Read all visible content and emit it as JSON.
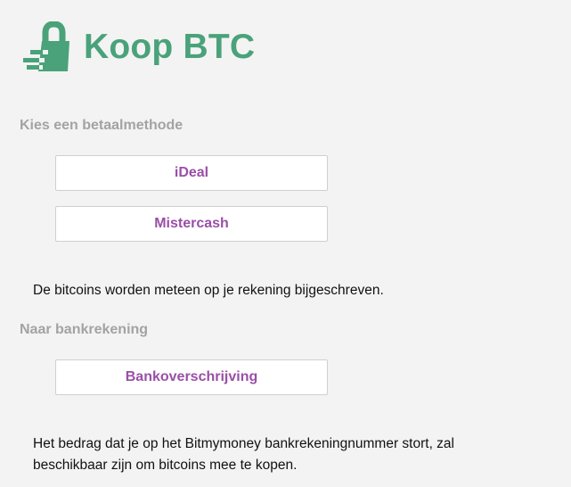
{
  "brand": {
    "title": "Koop BTC",
    "logo_icon": "padlock-speed-icon",
    "color": "#4aa27a"
  },
  "payment_section": {
    "label": "Kies een betaalmethode",
    "buttons": [
      {
        "label": "iDeal"
      },
      {
        "label": "Mistercash"
      }
    ],
    "note": "De bitcoins worden meteen op je rekening bijgeschreven."
  },
  "bank_section": {
    "label": "Naar bankrekening",
    "buttons": [
      {
        "label": "Bankoverschrijving"
      }
    ],
    "note_line1": "Het bedrag dat je op het Bitmymoney bankrekeningnummer stort, zal",
    "note_line2": "beschikbaar zijn om bitcoins mee te kopen."
  },
  "colors": {
    "accent_purple": "#9a4fa8",
    "label_gray": "#a3a3a3",
    "background": "#f3f3f3"
  }
}
